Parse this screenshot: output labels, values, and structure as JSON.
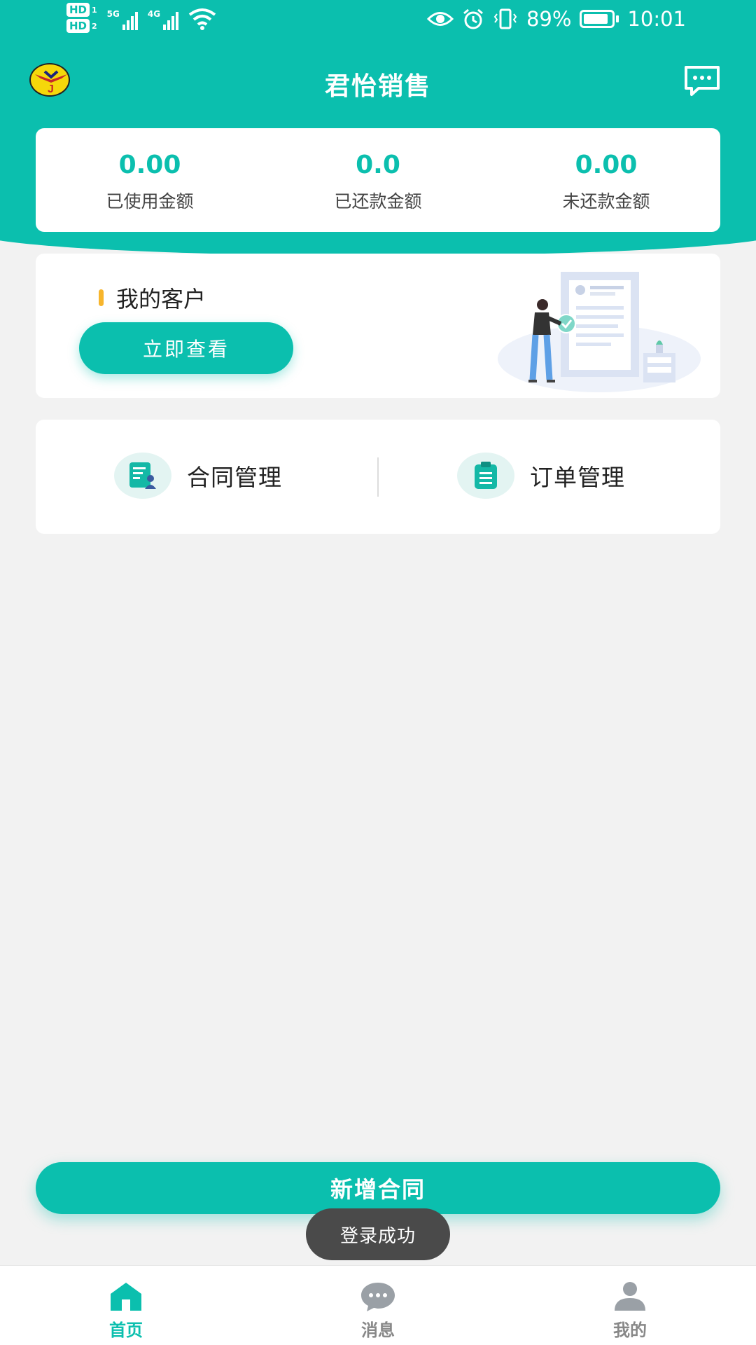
{
  "status_bar": {
    "hd1": "HD",
    "hd1_sub": "1",
    "hd2": "HD",
    "hd2_sub": "2",
    "net1_type": "5G",
    "net2_type": "4G",
    "battery_percent": "89%",
    "battery_level": 0.89,
    "time": "10:01"
  },
  "header": {
    "title": "君怡销售",
    "logo_icon": "company-logo-icon",
    "message_icon": "chat-bubble-icon"
  },
  "summary": {
    "items": [
      {
        "value": "0.00",
        "label": "已使用金额"
      },
      {
        "value": "0.0",
        "label": "已还款金额"
      },
      {
        "value": "0.00",
        "label": "未还款金额"
      }
    ]
  },
  "customers": {
    "title": "我的客户",
    "button_label": "立即查看"
  },
  "functions": {
    "contract": {
      "label": "合同管理",
      "icon": "contract-icon"
    },
    "order": {
      "label": "订单管理",
      "icon": "clipboard-icon"
    }
  },
  "actions": {
    "add_contract_label": "新增合同"
  },
  "toast": {
    "message": "登录成功"
  },
  "tabs": [
    {
      "label": "首页",
      "icon": "home-icon",
      "active": true
    },
    {
      "label": "消息",
      "icon": "message-icon",
      "active": false
    },
    {
      "label": "我的",
      "icon": "user-icon",
      "active": false
    }
  ],
  "colors": {
    "primary": "#0bbfae",
    "accent": "#f7b52c",
    "background": "#f2f2f2",
    "toast": "#4a4a4a"
  }
}
